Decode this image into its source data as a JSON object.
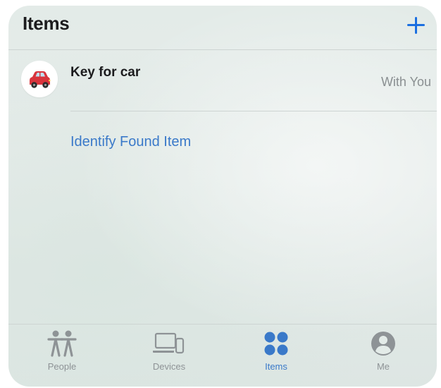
{
  "header": {
    "title": "Items",
    "add_icon": "plus-icon"
  },
  "items": [
    {
      "name": "Key for car",
      "status": "With You",
      "icon": "red-car-emoji-icon"
    }
  ],
  "identify_link": "Identify Found Item",
  "tabbar": {
    "tabs": [
      {
        "label": "People",
        "icon": "people-icon"
      },
      {
        "label": "Devices",
        "icon": "devices-icon"
      },
      {
        "label": "Items",
        "icon": "items-grid-icon",
        "active": true
      },
      {
        "label": "Me",
        "icon": "person-circle-icon"
      }
    ]
  },
  "colors": {
    "accent": "#3a79c9",
    "text_primary": "#1c1c1e",
    "text_secondary": "#8a8f91",
    "tab_inactive": "#8e9396"
  }
}
